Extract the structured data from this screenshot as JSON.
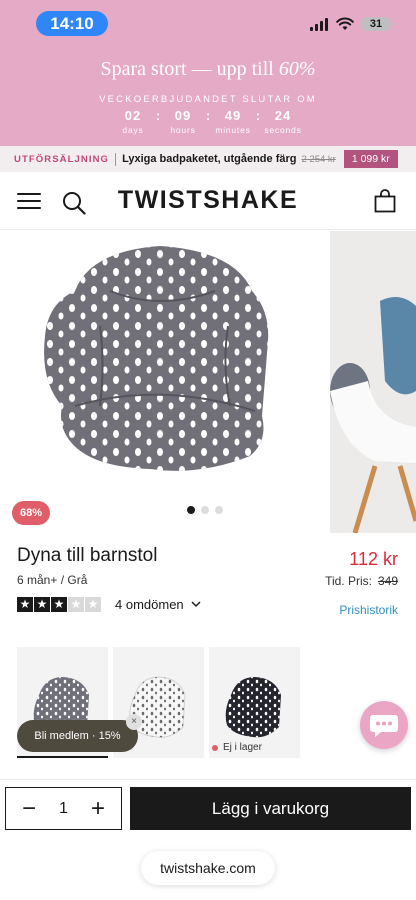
{
  "status_bar": {
    "time": "14:10",
    "battery": "31"
  },
  "promo": {
    "title_main": "Spara stort — upp till ",
    "title_pct": "60%",
    "subtitle": "VECKOERBJUDANDET SLUTAR OM",
    "countdown": [
      {
        "value": "02",
        "label": "days"
      },
      {
        "value": "09",
        "label": "hours"
      },
      {
        "value": "49",
        "label": "minutes"
      },
      {
        "value": "24",
        "label": "seconds"
      }
    ],
    "separator": ":"
  },
  "sale_bar": {
    "tag": "UTFÖRSÄLJNING",
    "text": "Lyxiga badpaketet, utgående färg",
    "old_price": "2 254 kr",
    "price": "1 099 kr"
  },
  "header": {
    "logo": "TWISTSHAKE"
  },
  "gallery": {
    "discount": "68%",
    "slide_count": 3,
    "active_slide": 0
  },
  "product": {
    "title": "Dyna till barnstol",
    "variant": "6 mån+ / Grå",
    "price": "112 kr",
    "tid_label": "Tid. Pris:",
    "old_price": "349",
    "rating": 3,
    "rating_max": 5,
    "reviews": "4 omdömen",
    "history_link": "Prishistorik"
  },
  "variants": [
    {
      "name": "grey",
      "selected": true
    },
    {
      "name": "white",
      "selected": false
    },
    {
      "name": "black",
      "selected": false,
      "stock": "Ej i lager"
    }
  ],
  "member_popup": {
    "label": "Bli medlem · 15%",
    "close": "×"
  },
  "purchase": {
    "qty": "1",
    "minus": "−",
    "plus": "+",
    "cart_label": "Lägg i varukorg"
  },
  "browser": {
    "url": "twistshake.com"
  },
  "colors": {
    "promo_bg": "#e5aac6",
    "sale_tag": "#c0487a",
    "price": "#d92c3a",
    "link": "#2f8fc0",
    "badge": "#e05d6a"
  }
}
